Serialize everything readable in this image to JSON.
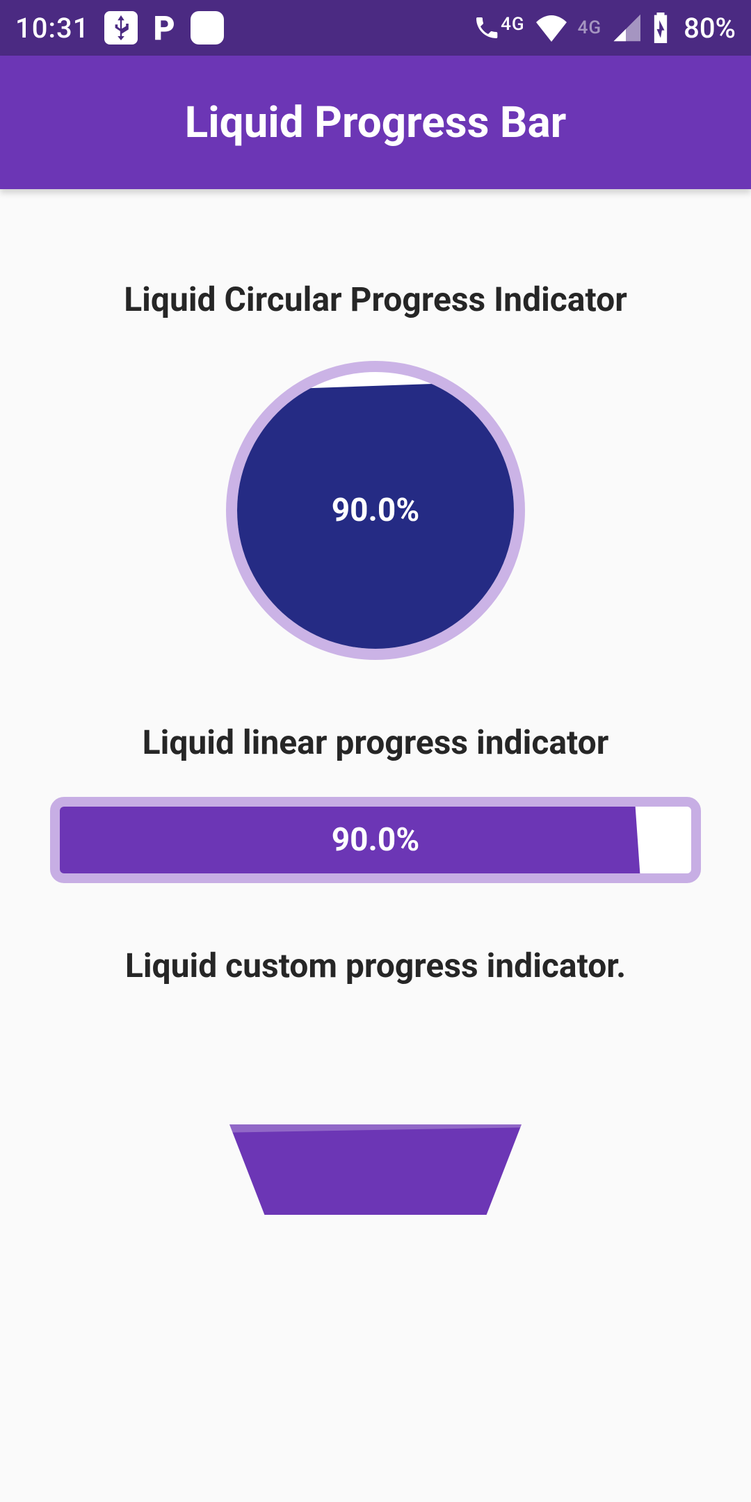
{
  "status": {
    "time": "10:31",
    "battery": "80%",
    "net_label_left": "4G",
    "net_label_right": "4G"
  },
  "app": {
    "title": "Liquid Progress Bar"
  },
  "sections": {
    "circular": {
      "title": "Liquid Circular Progress Indicator",
      "value": "90.0%",
      "percent": 90.0
    },
    "linear": {
      "title": "Liquid linear progress indicator",
      "value": "90.0%",
      "percent": 90.0
    },
    "custom": {
      "title": "Liquid custom progress indicator."
    }
  },
  "colors": {
    "status_bar": "#4b2a82",
    "app_bar": "#6c36b5",
    "circle_border": "#cbb3e6",
    "circle_fill": "#252b84",
    "linear_border": "#c7aee4",
    "linear_fill": "#6c36b5"
  }
}
